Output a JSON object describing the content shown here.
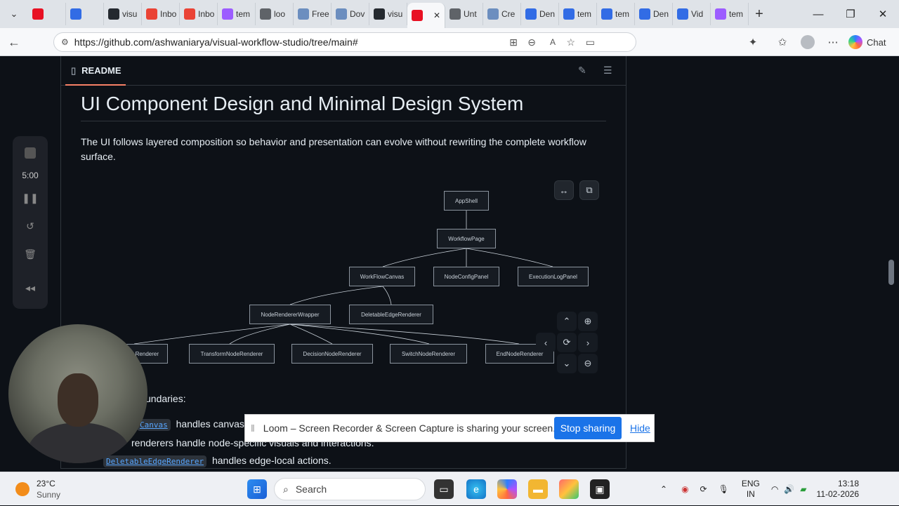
{
  "tabs": [
    {
      "label": "",
      "icon": "record-icon",
      "color": "#e81123"
    },
    {
      "label": "",
      "icon": "kubernetes-icon",
      "color": "#326ce5"
    },
    {
      "label": "visu",
      "icon": "github-icon",
      "color": "#24292f"
    },
    {
      "label": "Inbo",
      "icon": "gmail-icon",
      "color": "#ea4335"
    },
    {
      "label": "Inbo",
      "icon": "gmail-icon",
      "color": "#ea4335"
    },
    {
      "label": "tem",
      "icon": "vite-icon",
      "color": "#9c5cff"
    },
    {
      "label": "loo",
      "icon": "search-icon",
      "color": "#5f6368"
    },
    {
      "label": "Free",
      "icon": "gear-icon",
      "color": "#6c8ebf"
    },
    {
      "label": "Dov",
      "icon": "gear-icon",
      "color": "#6c8ebf"
    },
    {
      "label": "visu",
      "icon": "github-icon",
      "color": "#24292f"
    },
    {
      "label": "",
      "icon": "record-icon",
      "color": "#e81123"
    },
    {
      "label": "Unt",
      "icon": "drawio-icon",
      "color": "#5f6368"
    },
    {
      "label": "Cre",
      "icon": "gear-icon",
      "color": "#6c8ebf"
    },
    {
      "label": "Den",
      "icon": "kubernetes-icon",
      "color": "#326ce5"
    },
    {
      "label": "tem",
      "icon": "kubernetes-icon",
      "color": "#326ce5"
    },
    {
      "label": "tem",
      "icon": "kubernetes-icon",
      "color": "#326ce5"
    },
    {
      "label": "Den",
      "icon": "kubernetes-icon",
      "color": "#326ce5"
    },
    {
      "label": "Vid",
      "icon": "kubernetes-icon",
      "color": "#326ce5"
    },
    {
      "label": "tem",
      "icon": "vite-icon",
      "color": "#9c5cff"
    }
  ],
  "address": {
    "url": "https://github.com/ashwaniarya/visual-workflow-studio/tree/main#",
    "chat_label": "Chat"
  },
  "readme": {
    "header": "README",
    "title": "UI Component Design and Minimal Design System",
    "paragraph": "The UI follows layered composition so behavior and presentation can evolve without rewriting the complete workflow surface."
  },
  "diagram": {
    "nodes": [
      "AppShell",
      "WorkflowPage",
      "WorkFlowCanvas",
      "NodeConfigPanel",
      "ExecutionLogPanel",
      "NodeRendererWrapper",
      "DeletableEdgeRenderer",
      "Renderer",
      "TransformNodeRenderer",
      "DecisionNodeRenderer",
      "SwitchNodeRenderer",
      "EndNodeRenderer"
    ]
  },
  "body": {
    "boundaries_fragment": "undaries:",
    "line1_code": "Canvas",
    "line1_text": "handles canvas",
    "line2_text": "renderers handle node-specific visuals and interactions.",
    "line3_code": "DeletableEdgeRenderer",
    "line3_text": "handles edge-local actions."
  },
  "loom": {
    "timer": "5:00"
  },
  "share": {
    "message": "Loom – Screen Recorder & Screen Capture is sharing your screen.",
    "stop": "Stop sharing",
    "hide": "Hide"
  },
  "taskbar": {
    "temp": "23°C",
    "weather": "Sunny",
    "search": "Search",
    "lang1": "ENG",
    "lang2": "IN",
    "time": "13:18",
    "date": "11-02-2026"
  }
}
